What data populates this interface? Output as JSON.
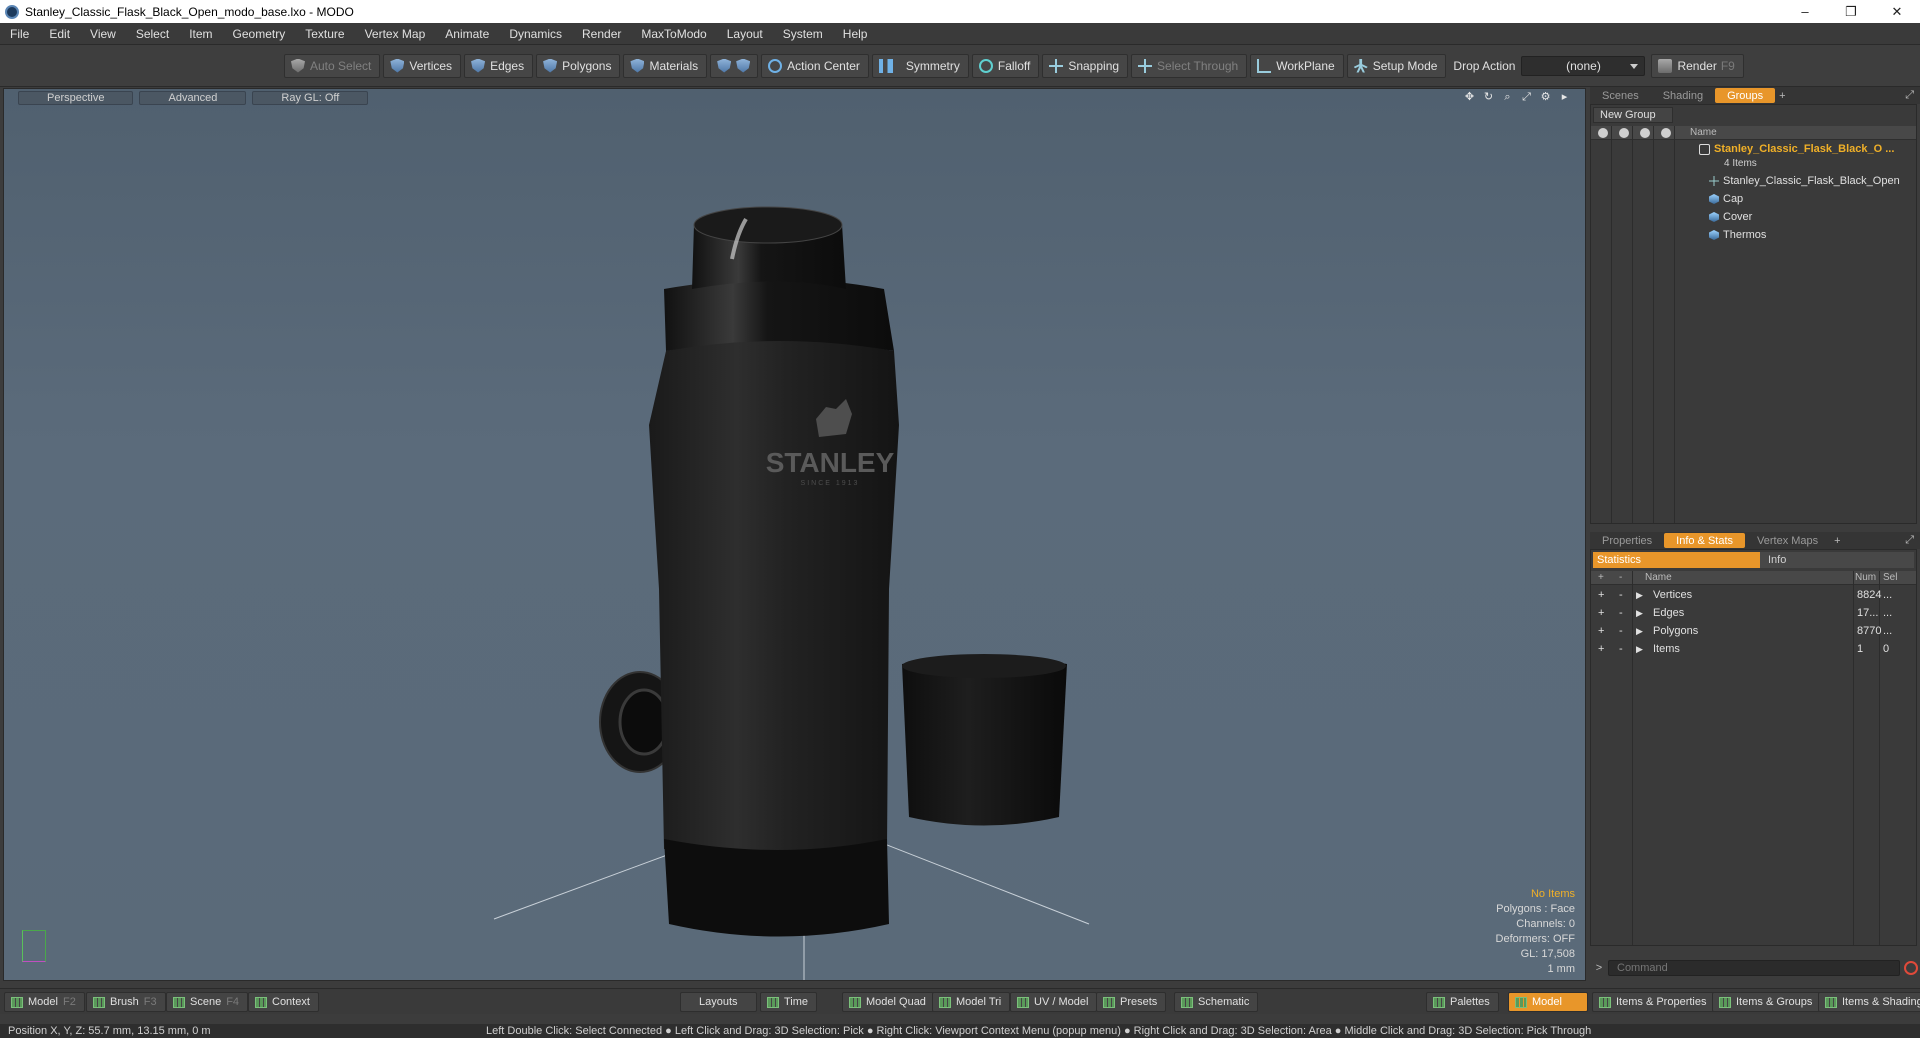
{
  "window": {
    "title": "Stanley_Classic_Flask_Black_Open_modo_base.lxo - MODO",
    "minimize": "–",
    "restore": "❐",
    "close": "✕"
  },
  "menu": [
    "File",
    "Edit",
    "View",
    "Select",
    "Item",
    "Geometry",
    "Texture",
    "Vertex Map",
    "Animate",
    "Dynamics",
    "Render",
    "MaxToModo",
    "Layout",
    "System",
    "Help"
  ],
  "toolbar": {
    "auto_select": "Auto Select",
    "vertices": "Vertices",
    "edges": "Edges",
    "polygons": "Polygons",
    "materials": "Materials",
    "action_center": "Action Center",
    "symmetry": "Symmetry",
    "falloff": "Falloff",
    "snapping": "Snapping",
    "select_through": "Select Through",
    "workplane": "WorkPlane",
    "setup_mode": "Setup Mode",
    "drop_action_label": "Drop Action",
    "drop_action_value": "(none)",
    "render": "Render",
    "render_key": "F9"
  },
  "viewport": {
    "tabs": [
      "Perspective",
      "Advanced",
      "Ray GL: Off"
    ],
    "info": {
      "no_items": "No Items",
      "polygons": "Polygons : Face",
      "channels": "Channels: 0",
      "deformers": "Deformers: OFF",
      "gl": "GL: 17,508",
      "scale": "1 mm"
    },
    "logo_text": "STANLEY",
    "logo_sub": "SINCE 1913"
  },
  "top_panel": {
    "tabs": [
      "Scenes",
      "Shading",
      "Groups"
    ],
    "active_tab": "Groups",
    "new_group": "New Group",
    "column_name": "Name",
    "root_group": "Stanley_Classic_Flask_Black_O ...",
    "root_count": "4 Items",
    "items": [
      "Stanley_Classic_Flask_Black_Open",
      "Cap",
      "Cover",
      "Thermos"
    ]
  },
  "bottom_panel": {
    "tabs": [
      "Properties",
      "Info & Stats",
      "Vertex Maps"
    ],
    "active_tab": "Info & Stats",
    "subtab_statistics": "Statistics",
    "subtab_info": "Info",
    "columns": {
      "name": "Name",
      "num": "Num",
      "sel": "Sel"
    },
    "rows": [
      {
        "name": "Vertices",
        "num": "8824",
        "sel": "..."
      },
      {
        "name": "Edges",
        "num": "17...",
        "sel": "..."
      },
      {
        "name": "Polygons",
        "num": "8770",
        "sel": "..."
      },
      {
        "name": "Items",
        "num": "1",
        "sel": "0"
      }
    ]
  },
  "command": {
    "placeholder": "Command"
  },
  "bottombar": {
    "model": "Model",
    "model_key": "F2",
    "brush": "Brush",
    "brush_key": "F3",
    "scene": "Scene",
    "scene_key": "F4",
    "context": "Context",
    "layouts": "Layouts",
    "time": "Time",
    "model_quad": "Model Quad",
    "model_tri": "Model Tri",
    "uv_model": "UV / Model",
    "presets": "Presets",
    "schematic": "Schematic",
    "palettes": "Palettes",
    "model_active": "Model",
    "items_properties": "Items & Properties",
    "items_groups": "Items & Groups",
    "items_shading": "Items & Shading"
  },
  "status": {
    "position": "Position X, Y, Z:   55.7 mm, 13.15 mm, 0 m",
    "hint": "Left Double Click: Select Connected ● Left Click and Drag: 3D Selection: Pick ● Right Click: Viewport Context Menu (popup menu) ● Right Click and Drag: 3D Selection: Area ● Middle Click and Drag: 3D Selection: Pick Through"
  },
  "colors": {
    "accent": "#e8962a",
    "viewport_bg": "#596979",
    "root_group": "#f0b028"
  }
}
